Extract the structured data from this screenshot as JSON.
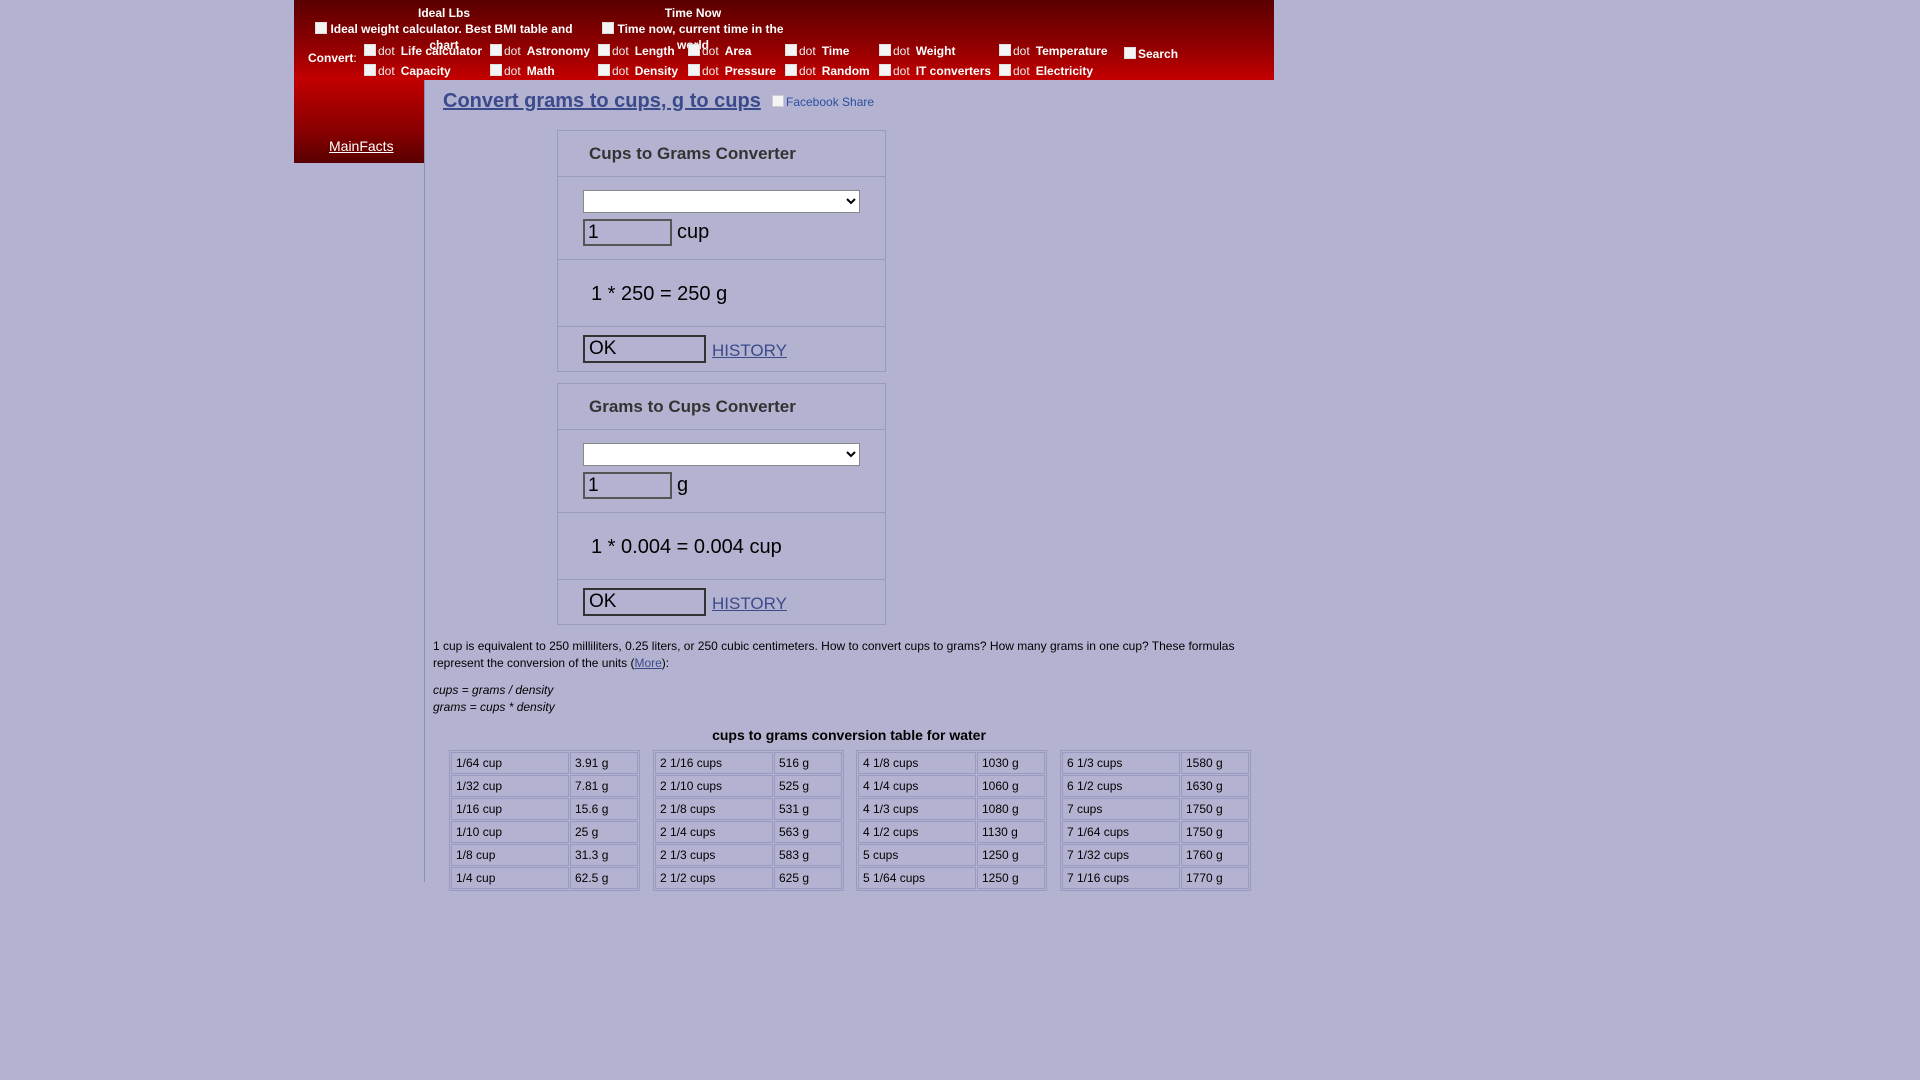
{
  "header": {
    "promo_left": {
      "title": "Ideal Lbs",
      "image_alt": "Ideal weight calculator. Best BMI table and chart"
    },
    "promo_right": {
      "title": "Time Now",
      "image_alt": "Time now, current time in the world"
    },
    "convert_label": "Convert",
    "convert_colon": ":",
    "dot_alt": "dot",
    "nav": {
      "row1": [
        "Life calculator",
        "Astronomy",
        "Length",
        "Area",
        "Time",
        "Weight",
        "Temperature"
      ],
      "row2": [
        "Capacity",
        "Math",
        "Density",
        "Pressure",
        "Random",
        "IT converters",
        "Electricity"
      ]
    },
    "search_alt": "Search"
  },
  "sidebar": {
    "mainfacts": "MainFacts"
  },
  "main": {
    "title": "Convert grams to cups, g to cups",
    "facebook_share": "Facebook Share",
    "converter1": {
      "title": "Cups to Grams Converter",
      "select_value": "",
      "input_value": "1",
      "unit": "cup",
      "result": "1 * 250 = 250 g",
      "ok_label": "OK",
      "history_label": "HISTORY"
    },
    "converter2": {
      "title": "Grams to Cups Converter",
      "select_value": "",
      "input_value": "1",
      "unit": "g",
      "result": "1 * 0.004 = 0.004 cup",
      "ok_label": "OK",
      "history_label": "HISTORY"
    },
    "description": "1 cup is equivalent to 250 milliliters, 0.25 liters, or 250 cubic centimeters. How to convert cups to grams? How many grams in one cup? These formulas represent the conversion of the units (",
    "more_link": "More",
    "description_end": "):",
    "formula1": "cups = grams / density",
    "formula2": "grams = cups * density",
    "table_title": "cups to grams conversion table for water",
    "table": [
      [
        [
          "1/64 cup",
          "3.91 g"
        ],
        [
          "1/32 cup",
          "7.81 g"
        ],
        [
          "1/16 cup",
          "15.6 g"
        ],
        [
          "1/10 cup",
          "25 g"
        ],
        [
          "1/8 cup",
          "31.3 g"
        ],
        [
          "1/4 cup",
          "62.5 g"
        ]
      ],
      [
        [
          "2 1/16 cups",
          "516 g"
        ],
        [
          "2 1/10 cups",
          "525 g"
        ],
        [
          "2 1/8 cups",
          "531 g"
        ],
        [
          "2 1/4 cups",
          "563 g"
        ],
        [
          "2 1/3 cups",
          "583 g"
        ],
        [
          "2 1/2 cups",
          "625 g"
        ]
      ],
      [
        [
          "4 1/8 cups",
          "1030 g"
        ],
        [
          "4 1/4 cups",
          "1060 g"
        ],
        [
          "4 1/3 cups",
          "1080 g"
        ],
        [
          "4 1/2 cups",
          "1130 g"
        ],
        [
          "5 cups",
          "1250 g"
        ],
        [
          "5 1/64 cups",
          "1250 g"
        ]
      ],
      [
        [
          "6 1/3 cups",
          "1580 g"
        ],
        [
          "6 1/2 cups",
          "1630 g"
        ],
        [
          "7 cups",
          "1750 g"
        ],
        [
          "7 1/64 cups",
          "1750 g"
        ],
        [
          "7 1/32 cups",
          "1760 g"
        ],
        [
          "7 1/16 cups",
          "1770 g"
        ]
      ]
    ]
  }
}
